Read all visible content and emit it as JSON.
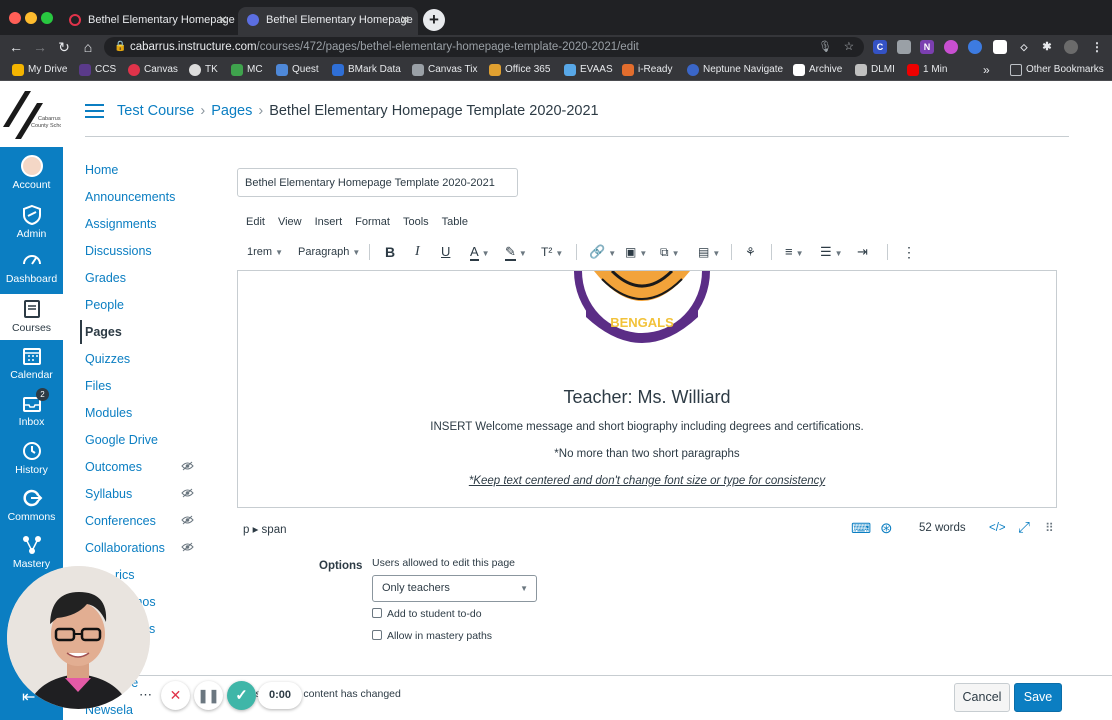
{
  "browser": {
    "tabs": [
      {
        "title": "Bethel Elementary Homepage",
        "close": "✕"
      },
      {
        "title": "Bethel Elementary Homepage",
        "close": "✕"
      }
    ],
    "new_tab": "+",
    "url_host": "cabarrus.instructure.com",
    "url_path": "/courses/472/pages/bethel-elementary-homepage-template-2020-2021/edit",
    "bookmarks": [
      "My Drive",
      "CCS",
      "Canvas",
      "TK",
      "MC",
      "Quest",
      "BMark Data",
      "Canvas Tix",
      "Office 365",
      "EVAAS",
      "i-Ready",
      "Neptune Navigate",
      "Archive",
      "DLMI",
      "1 Min"
    ],
    "bookmarks_overflow": "»",
    "other_bookmarks": "Other Bookmarks"
  },
  "global_nav": {
    "logo_text": "Cabarrus County Schools",
    "items": [
      {
        "label": "Account"
      },
      {
        "label": "Admin"
      },
      {
        "label": "Dashboard"
      },
      {
        "label": "Courses"
      },
      {
        "label": "Calendar"
      },
      {
        "label": "Inbox",
        "badge": "2"
      },
      {
        "label": "History"
      },
      {
        "label": "Commons"
      },
      {
        "label": "Mastery"
      }
    ]
  },
  "breadcrumb": {
    "course": "Test Course",
    "section": "Pages",
    "current": "Bethel Elementary Homepage Template 2020-2021",
    "separator": "›"
  },
  "course_nav": {
    "items": [
      "Home",
      "Announcements",
      "Assignments",
      "Discussions",
      "Grades",
      "People",
      "Pages",
      "Quizzes",
      "Files",
      "Modules",
      "Google Drive",
      "Outcomes",
      "Syllabus",
      "Conferences",
      "Collaborations",
      "rics",
      "mos",
      "ics",
      "ce",
      "Newsela"
    ]
  },
  "editor": {
    "title_value": "Bethel Elementary Homepage Template 2020-2021",
    "menus": [
      "Edit",
      "View",
      "Insert",
      "Format",
      "Tools",
      "Table"
    ],
    "font_size": "1rem",
    "block_format": "Paragraph",
    "image_text": "BENGALS",
    "heading": "Teacher: Ms. Williard",
    "paragraph_1": "INSERT Welcome message and short biography including degrees and certifications.",
    "paragraph_2": "*No more than two short paragraphs",
    "paragraph_3": "*Keep text centered and don't change font size or type for consistency",
    "path": "p ▸ span",
    "word_count": "52 words",
    "html_toggle": "</>"
  },
  "options": {
    "label": "Options",
    "edit_caption": "Users allowed to edit this page",
    "edit_selected": "Only teachers",
    "todo_label": "Add to student to-do",
    "mastery_label": "Allow in mastery paths"
  },
  "footer": {
    "notify_text": "rs that this content has changed",
    "cancel": "Cancel",
    "save": "Save"
  },
  "recorder": {
    "time": "0:00",
    "more": "⋯"
  }
}
